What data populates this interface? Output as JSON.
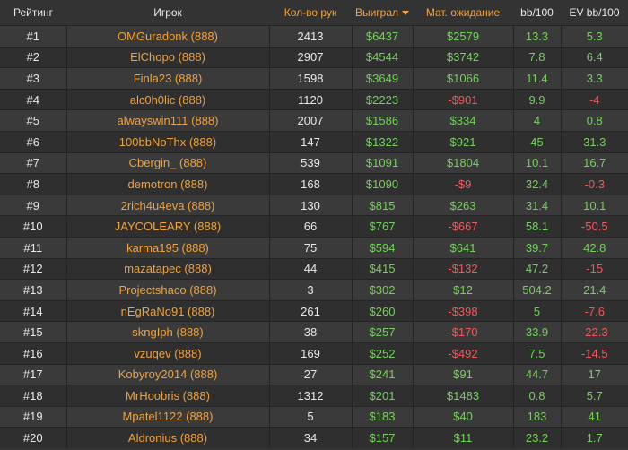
{
  "headers": {
    "rank": "Рейтинг",
    "player": "Игрок",
    "hands": "Кол-во рук",
    "won": "Выиграл",
    "ev": "Мат. ожидание",
    "bb100": "bb/100",
    "evbb100": "EV bb/100"
  },
  "colors": {
    "positive": "#73d25a",
    "negative": "#f05a5a",
    "accent": "#f0a23c"
  },
  "rows": [
    {
      "rank": "#1",
      "player": "OMGuradonk (888)",
      "hands": "2413",
      "won": "$6437",
      "ev": "$2579",
      "bb100": "13.3",
      "evbb100": "5.3"
    },
    {
      "rank": "#2",
      "player": "ElChopo (888)",
      "hands": "2907",
      "won": "$4544",
      "ev": "$3742",
      "bb100": "7.8",
      "evbb100": "6.4"
    },
    {
      "rank": "#3",
      "player": "Finla23 (888)",
      "hands": "1598",
      "won": "$3649",
      "ev": "$1066",
      "bb100": "11.4",
      "evbb100": "3.3"
    },
    {
      "rank": "#4",
      "player": "alc0h0lic (888)",
      "hands": "1120",
      "won": "$2223",
      "ev": "-$901",
      "bb100": "9.9",
      "evbb100": "-4"
    },
    {
      "rank": "#5",
      "player": "alwayswin111 (888)",
      "hands": "2007",
      "won": "$1586",
      "ev": "$334",
      "bb100": "4",
      "evbb100": "0.8"
    },
    {
      "rank": "#6",
      "player": "100bbNoThx (888)",
      "hands": "147",
      "won": "$1322",
      "ev": "$921",
      "bb100": "45",
      "evbb100": "31.3"
    },
    {
      "rank": "#7",
      "player": "Cbergin_ (888)",
      "hands": "539",
      "won": "$1091",
      "ev": "$1804",
      "bb100": "10.1",
      "evbb100": "16.7"
    },
    {
      "rank": "#8",
      "player": "demotron (888)",
      "hands": "168",
      "won": "$1090",
      "ev": "-$9",
      "bb100": "32.4",
      "evbb100": "-0.3"
    },
    {
      "rank": "#9",
      "player": "2rich4u4eva (888)",
      "hands": "130",
      "won": "$815",
      "ev": "$263",
      "bb100": "31.4",
      "evbb100": "10.1"
    },
    {
      "rank": "#10",
      "player": "JAYCOLEARY (888)",
      "hands": "66",
      "won": "$767",
      "ev": "-$667",
      "bb100": "58.1",
      "evbb100": "-50.5"
    },
    {
      "rank": "#11",
      "player": "karma195 (888)",
      "hands": "75",
      "won": "$594",
      "ev": "$641",
      "bb100": "39.7",
      "evbb100": "42.8"
    },
    {
      "rank": "#12",
      "player": "mazatapec (888)",
      "hands": "44",
      "won": "$415",
      "ev": "-$132",
      "bb100": "47.2",
      "evbb100": "-15"
    },
    {
      "rank": "#13",
      "player": "Projectshaco (888)",
      "hands": "3",
      "won": "$302",
      "ev": "$12",
      "bb100": "504.2",
      "evbb100": "21.4"
    },
    {
      "rank": "#14",
      "player": "nEgRaNo91 (888)",
      "hands": "261",
      "won": "$260",
      "ev": "-$398",
      "bb100": "5",
      "evbb100": "-7.6"
    },
    {
      "rank": "#15",
      "player": "skngIph (888)",
      "hands": "38",
      "won": "$257",
      "ev": "-$170",
      "bb100": "33.9",
      "evbb100": "-22.3"
    },
    {
      "rank": "#16",
      "player": "vzuqev (888)",
      "hands": "169",
      "won": "$252",
      "ev": "-$492",
      "bb100": "7.5",
      "evbb100": "-14.5"
    },
    {
      "rank": "#17",
      "player": "Kobyroy2014 (888)",
      "hands": "27",
      "won": "$241",
      "ev": "$91",
      "bb100": "44.7",
      "evbb100": "17"
    },
    {
      "rank": "#18",
      "player": "MrHoobris (888)",
      "hands": "1312",
      "won": "$201",
      "ev": "$1483",
      "bb100": "0.8",
      "evbb100": "5.7"
    },
    {
      "rank": "#19",
      "player": "Mpatel1122 (888)",
      "hands": "5",
      "won": "$183",
      "ev": "$40",
      "bb100": "183",
      "evbb100": "41"
    },
    {
      "rank": "#20",
      "player": "Aldronius (888)",
      "hands": "34",
      "won": "$157",
      "ev": "$11",
      "bb100": "23.2",
      "evbb100": "1.7"
    }
  ]
}
